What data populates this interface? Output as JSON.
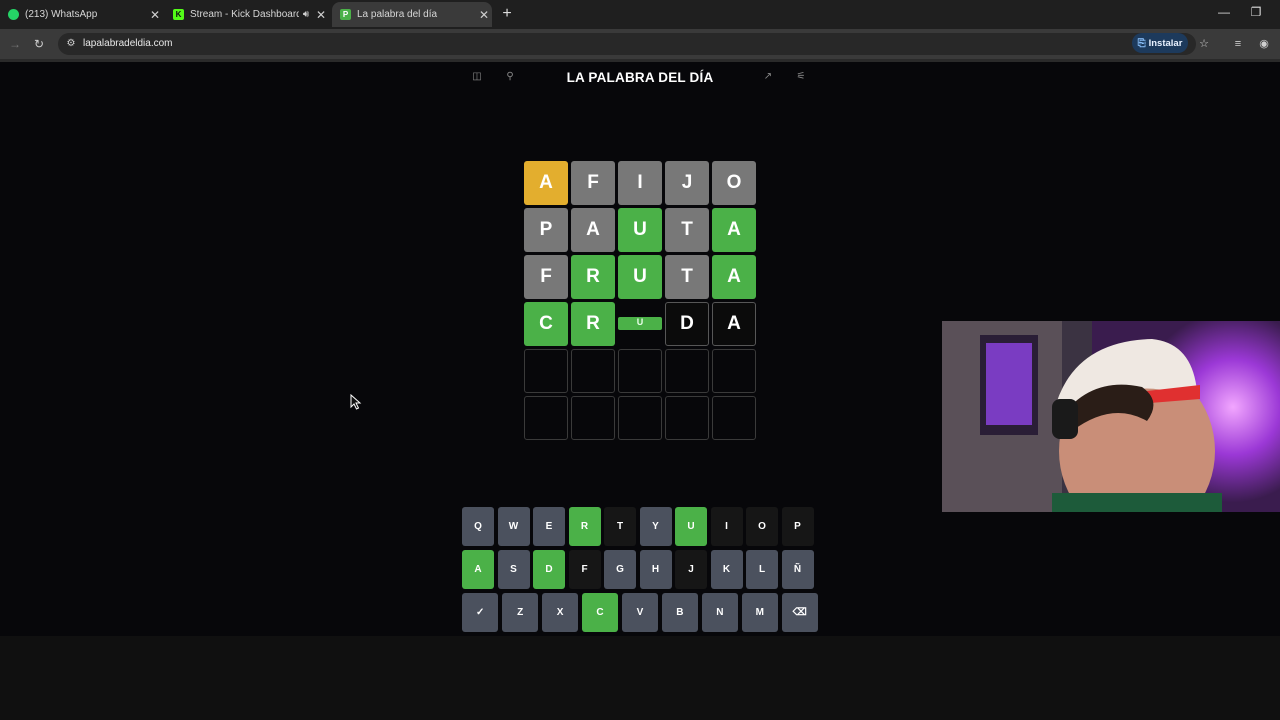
{
  "browser": {
    "tabs": [
      {
        "title": "(213) WhatsApp",
        "icon": "whatsapp-icon",
        "color": "#25d366"
      },
      {
        "title": "Stream - Kick Dashboard",
        "icon": "kick-icon",
        "color": "#53fc18",
        "fav_letter": "K"
      },
      {
        "title": "La palabra del día",
        "icon": "site-icon",
        "color": "#4bb148",
        "fav_letter": "P",
        "active": true
      }
    ],
    "url": "lapalabradeldia.com",
    "install_label": "Instalar"
  },
  "game": {
    "title": "LA PALABRA DEL DÍA",
    "board": [
      [
        {
          "l": "A",
          "s": "present"
        },
        {
          "l": "F",
          "s": "absent"
        },
        {
          "l": "I",
          "s": "absent"
        },
        {
          "l": "J",
          "s": "absent"
        },
        {
          "l": "O",
          "s": "absent"
        }
      ],
      [
        {
          "l": "P",
          "s": "absent"
        },
        {
          "l": "A",
          "s": "absent"
        },
        {
          "l": "U",
          "s": "correct"
        },
        {
          "l": "T",
          "s": "absent"
        },
        {
          "l": "A",
          "s": "correct"
        }
      ],
      [
        {
          "l": "F",
          "s": "absent"
        },
        {
          "l": "R",
          "s": "correct"
        },
        {
          "l": "U",
          "s": "correct"
        },
        {
          "l": "T",
          "s": "absent"
        },
        {
          "l": "A",
          "s": "correct"
        }
      ],
      [
        {
          "l": "C",
          "s": "correct"
        },
        {
          "l": "R",
          "s": "correct"
        },
        {
          "l": "U",
          "s": "flipping"
        },
        {
          "l": "D",
          "s": "filled"
        },
        {
          "l": "A",
          "s": "filled"
        }
      ],
      [
        {
          "l": "",
          "s": "empty"
        },
        {
          "l": "",
          "s": "empty"
        },
        {
          "l": "",
          "s": "empty"
        },
        {
          "l": "",
          "s": "empty"
        },
        {
          "l": "",
          "s": "empty"
        }
      ],
      [
        {
          "l": "",
          "s": "empty"
        },
        {
          "l": "",
          "s": "empty"
        },
        {
          "l": "",
          "s": "empty"
        },
        {
          "l": "",
          "s": "empty"
        },
        {
          "l": "",
          "s": "empty"
        }
      ]
    ],
    "keyboard": [
      [
        {
          "k": "Q",
          "s": "unused"
        },
        {
          "k": "W",
          "s": "unused"
        },
        {
          "k": "E",
          "s": "unused"
        },
        {
          "k": "R",
          "s": "correct"
        },
        {
          "k": "T",
          "s": "absent"
        },
        {
          "k": "Y",
          "s": "unused"
        },
        {
          "k": "U",
          "s": "correct"
        },
        {
          "k": "I",
          "s": "absent"
        },
        {
          "k": "O",
          "s": "absent"
        },
        {
          "k": "P",
          "s": "absent"
        }
      ],
      [
        {
          "k": "A",
          "s": "correct"
        },
        {
          "k": "S",
          "s": "unused"
        },
        {
          "k": "D",
          "s": "correct"
        },
        {
          "k": "F",
          "s": "absent"
        },
        {
          "k": "G",
          "s": "unused"
        },
        {
          "k": "H",
          "s": "unused"
        },
        {
          "k": "J",
          "s": "absent"
        },
        {
          "k": "K",
          "s": "unused"
        },
        {
          "k": "L",
          "s": "unused"
        },
        {
          "k": "Ñ",
          "s": "unused"
        }
      ],
      [
        {
          "k": "✓",
          "s": "unused",
          "name": "enter"
        },
        {
          "k": "Z",
          "s": "unused"
        },
        {
          "k": "X",
          "s": "unused"
        },
        {
          "k": "C",
          "s": "correct"
        },
        {
          "k": "V",
          "s": "unused"
        },
        {
          "k": "B",
          "s": "unused"
        },
        {
          "k": "N",
          "s": "unused"
        },
        {
          "k": "M",
          "s": "unused"
        },
        {
          "k": "⌫",
          "s": "unused",
          "name": "backspace"
        }
      ]
    ]
  },
  "colors": {
    "correct": "#4bb148",
    "present": "#e3ae2e",
    "absent": "#787878",
    "key_unused": "#4b515e"
  }
}
